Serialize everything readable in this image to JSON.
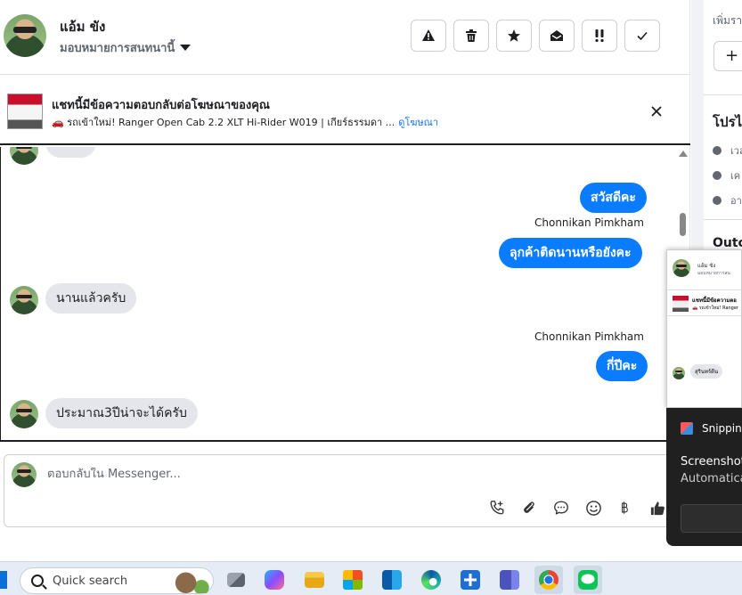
{
  "header": {
    "contact_name": "แอ้ม ขัง",
    "assign_label": "มอบหมายการสนทนานี้"
  },
  "ad_banner": {
    "title": "แชทนี้มีข้อความตอบกลับต่อโฆษณาของคุณ",
    "description": "🚗 รถเข้าใหม่! Ranger Open Cab 2.2 XLT Hi-Rider W019 | เกียร์ธรรมดา ...",
    "link_label": "ดูโฆษณา"
  },
  "messages": [
    {
      "direction": "in",
      "text": "สนใจ"
    },
    {
      "direction": "out",
      "text": "สวัสดีคะ"
    },
    {
      "direction": "out",
      "sender": "Chonnikan Pimkham",
      "text": "ลุกค้าติดนานหรือยังคะ"
    },
    {
      "direction": "in",
      "text": "นานแล้วครับ"
    },
    {
      "direction": "out",
      "sender": "Chonnikan Pimkham",
      "text": "กี่ปีคะ"
    },
    {
      "direction": "in",
      "text": "ประมาณ3ปีน่าจะได้ครับ"
    }
  ],
  "composer": {
    "placeholder": "ตอบกลับใน Messenger..."
  },
  "right_panel": {
    "add_label": "เพิ่มรา",
    "plus_label": "+",
    "profile_title": "โปรไ",
    "rows": [
      "เวล",
      "เค",
      "อา"
    ],
    "outcome_title": "Outc"
  },
  "snip_preview": {
    "name": "แอ้ม ขัง",
    "sub": "มอบหมายการสน",
    "banner_title": "แชทนี้มีข้อความตอ",
    "banner_desc": "🚗 รถเข้าใหม่! Ranger",
    "bubble": "สุรินทร์ดีน"
  },
  "snip_toast": {
    "app_name": "Snipping",
    "title": "Screenshot",
    "body": "Automatica"
  },
  "taskbar": {
    "search_label": "Quick search",
    "apps": [
      "task-view-icon",
      "copilot-icon",
      "file-explorer-icon",
      "store-icon",
      "outlook-icon",
      "edge-icon",
      "plus-app-icon",
      "teams-icon",
      "chrome-icon",
      "line-icon"
    ]
  },
  "colors": {
    "messenger_blue": "#0a7cff",
    "incoming_bubble": "#e4e6eb",
    "link": "#1877f2"
  }
}
